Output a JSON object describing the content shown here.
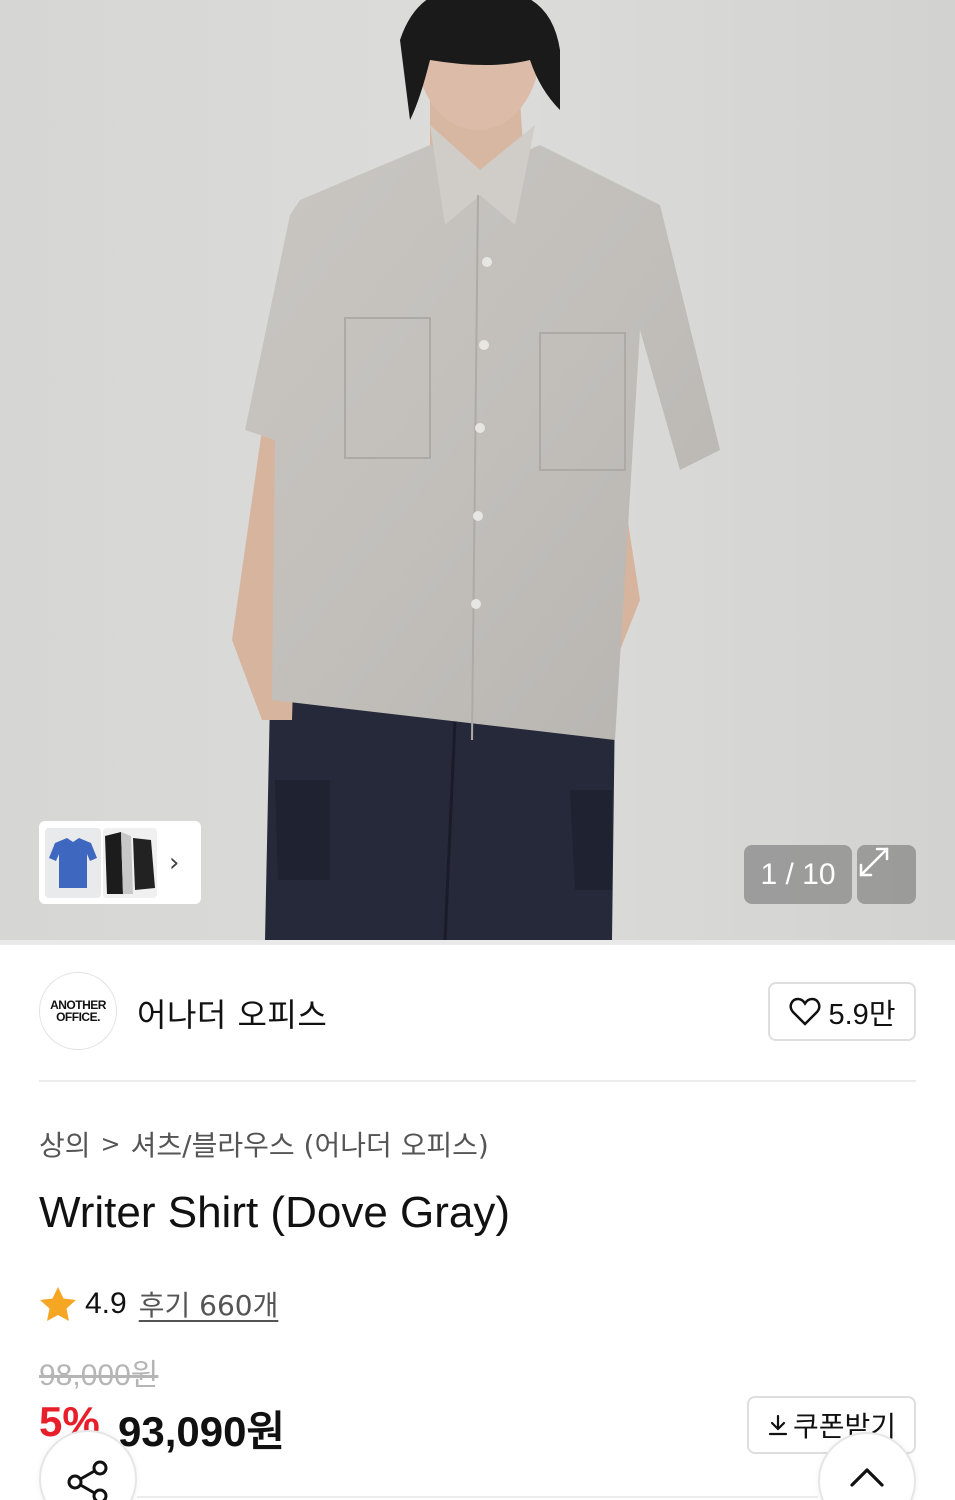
{
  "gallery": {
    "counter": "1 / 10",
    "thumbnails": [
      "blue-shirt-thumb",
      "black-shirt-thumb"
    ],
    "icons": {
      "next": "chevron-right-icon",
      "expand": "expand-icon"
    }
  },
  "brand": {
    "logo_line1": "ANOTHER",
    "logo_line2": "OFFICE.",
    "name": "어나더 오피스",
    "like_count": "5.9만"
  },
  "breadcrumb": {
    "items": [
      "상의",
      "셔츠/블라우스 (어나더 오피스)"
    ],
    "separator": ">"
  },
  "product": {
    "title": "Writer Shirt (Dove Gray)",
    "rating": "4.9",
    "reviews_label": "후기 660개",
    "original_price": "98,000원",
    "discount_rate": "5%",
    "sale_price": "93,090원"
  },
  "actions": {
    "coupon_label": "쿠폰받기",
    "share_icon": "share-icon",
    "top_icon": "chevron-up-icon"
  },
  "colors": {
    "discount": "#e81f2a",
    "star": "#f5a623",
    "border": "#dedede"
  }
}
